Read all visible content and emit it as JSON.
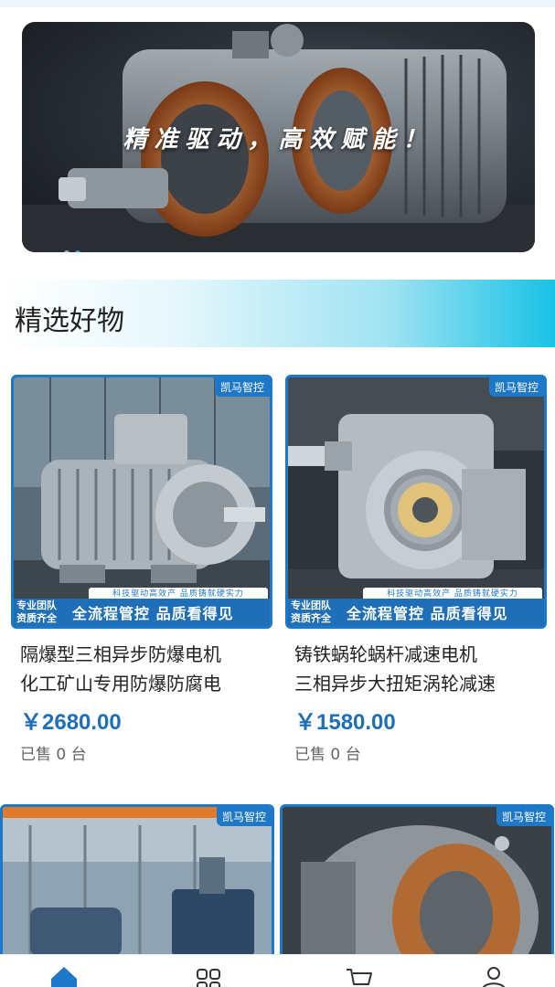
{
  "banner": {
    "caption": "精准驱动，高效赋能！",
    "slide_count": 2,
    "active_index": 1
  },
  "section": {
    "title": "精选好物"
  },
  "products": [
    {
      "brand": "凯马智控",
      "slogan_small": "科技驱动高效产 品质铸就硬实力",
      "team_line1": "专业团队",
      "team_line2": "资质齐全",
      "banner_text": "全流程管控 品质看得见",
      "title_line1": "隔爆型三相异步防爆电机",
      "title_line2": "化工矿山专用防爆防腐电",
      "price": "￥2680.00",
      "sold": "已售 0 台"
    },
    {
      "brand": "凯马智控",
      "slogan_small": "科技驱动高效产 品质铸就硬实力",
      "team_line1": "专业团队",
      "team_line2": "资质齐全",
      "banner_text": "全流程管控 品质看得见",
      "title_line1": "铸铁蜗轮蜗杆减速电机",
      "title_line2": "三相异步大扭矩涡轮减速",
      "price": "￥1580.00",
      "sold": "已售 0 台"
    },
    {
      "brand": "凯马智控"
    },
    {
      "brand": "凯马智控"
    }
  ],
  "nav": {
    "active": "home",
    "active_color": "#1e78c8"
  },
  "colors": {
    "accent": "#1e78c8",
    "price": "#1e6fb8",
    "header_gradient_end": "#18c2e6"
  }
}
